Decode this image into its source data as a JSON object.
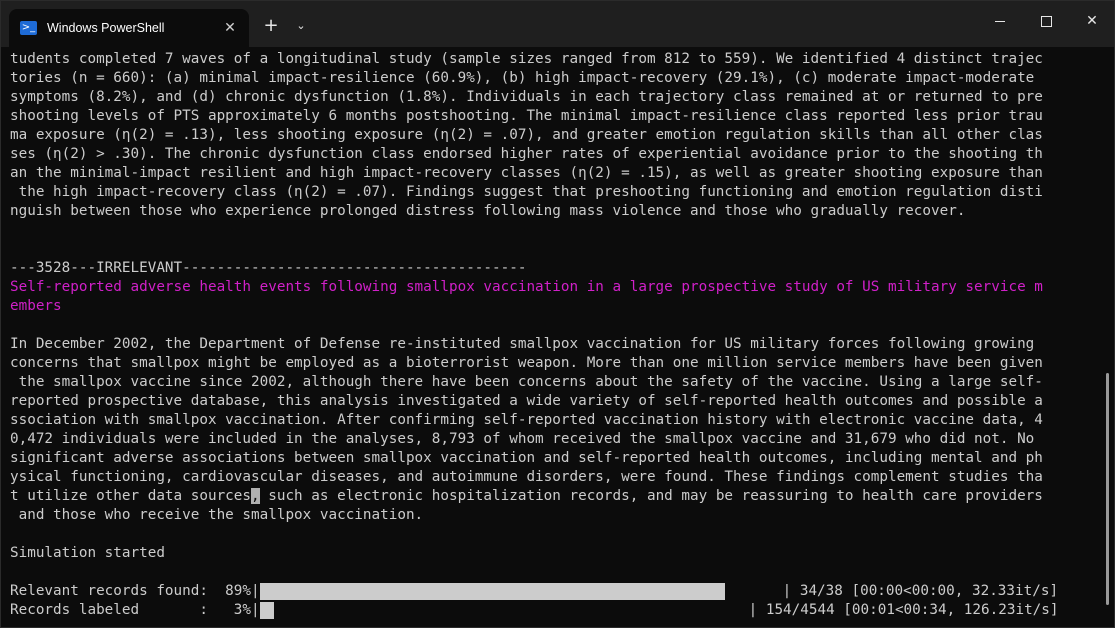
{
  "window": {
    "tab_title": "Windows PowerShell",
    "tab_icon": "powershell-icon",
    "new_tab_glyph": "+",
    "dropdown_glyph": "⌄",
    "close_tab_glyph": "✕",
    "close_glyph": "✕"
  },
  "terminal": {
    "lines": [
      "tudents completed 7 waves of a longitudinal study (sample sizes ranged from 812 to 559). We identified 4 distinct trajec",
      "tories (n = 660): (a) minimal impact-resilience (60.9%), (b) high impact-recovery (29.1%), (c) moderate impact-moderate",
      "symptoms (8.2%), and (d) chronic dysfunction (1.8%). Individuals in each trajectory class remained at or returned to pre",
      "shooting levels of PTS approximately 6 months postshooting. The minimal impact-resilience class reported less prior trau",
      "ma exposure (η(2) = .13), less shooting exposure (η(2) = .07), and greater emotion regulation skills than all other clas",
      "ses (η(2) > .30). The chronic dysfunction class endorsed higher rates of experiential avoidance prior to the shooting th",
      "an the minimal-impact resilient and high impact-recovery classes (η(2) = .15), as well as greater shooting exposure than",
      " the high impact-recovery class (η(2) = .07). Findings suggest that preshooting functioning and emotion regulation disti",
      "nguish between those who experience prolonged distress following mass violence and those who gradually recover.",
      "",
      "",
      "---3528---IRRELEVANT----------------------------------------"
    ],
    "title_lines": [
      "Self-reported adverse health events following smallpox vaccination in a large prospective study of US military service m",
      "embers"
    ],
    "abstract_lines": [
      "In December 2002, the Department of Defense re-instituted smallpox vaccination for US military forces following growing",
      "concerns that smallpox might be employed as a bioterrorist weapon. More than one million service members have been given",
      " the smallpox vaccine since 2002, although there have been concerns about the safety of the vaccine. Using a large self-",
      "reported prospective database, this analysis investigated a wide variety of self-reported health outcomes and possible a",
      "ssociation with smallpox vaccination. After confirming self-reported vaccination history with electronic vaccine data, 4",
      "0,472 individuals were included in the analyses, 8,793 of whom received the smallpox vaccine and 31,679 who did not. No",
      "significant adverse associations between smallpox vaccination and self-reported health outcomes, including mental and ph",
      "ysical functioning, cardiovascular diseases, and autoimmune disorders, were found. These findings complement studies tha"
    ],
    "cursor_line": {
      "before": "t utilize other data sources",
      "cursor": ",",
      "after": " such as electronic hospitalization records, and may be reassuring to health care providers"
    },
    "last_abstract_line": " and those who receive the smallpox vaccination.",
    "status": "Simulation started",
    "progress": [
      {
        "label": "Relevant records found:  89%|",
        "percent": 89,
        "suffix": "| 34/38 [00:00<00:00, 32.33it/s]"
      },
      {
        "label": "Records labeled       :   3%|",
        "percent": 3,
        "suffix": "| 154/4544 [00:01<00:34, 126.23it/s]"
      }
    ]
  },
  "colors": {
    "background": "#0c0c0c",
    "text": "#cccccc",
    "title_magenta": "#d020c8",
    "titlebar": "#1f1f1f"
  }
}
